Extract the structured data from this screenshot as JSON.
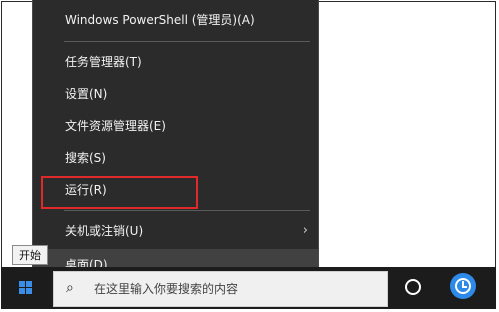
{
  "menu": {
    "items": [
      {
        "label": "Windows PowerShell (管理员)(A)"
      },
      {
        "label": "任务管理器(T)"
      },
      {
        "label": "设置(N)"
      },
      {
        "label": "文件资源管理器(E)"
      },
      {
        "label": "搜索(S)"
      },
      {
        "label": "运行(R)"
      },
      {
        "label": "关机或注销(U)"
      },
      {
        "label": "桌面(D)"
      }
    ],
    "submenu_chevron": "›"
  },
  "tooltip": {
    "text": "开始"
  },
  "taskbar": {
    "search_placeholder": "在这里输入你要搜索的内容",
    "icons": [
      "windows-logo-icon",
      "search-icon",
      "cortana-icon",
      "clock-icon"
    ]
  },
  "colors": {
    "menu_bg": "#2b2b2b",
    "hover_bg": "#414141",
    "highlight_border": "#e02a2a",
    "accent": "#2d8ae8"
  }
}
